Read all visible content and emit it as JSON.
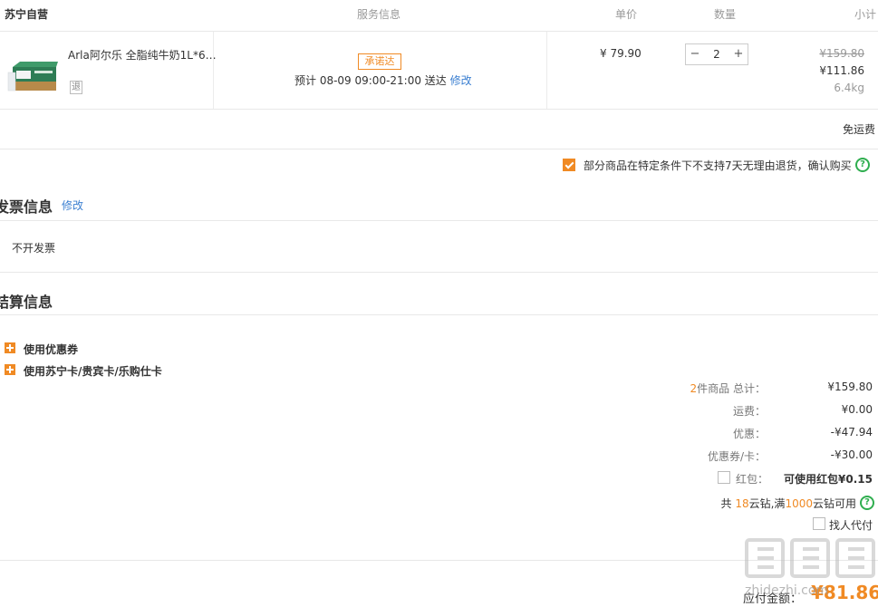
{
  "table_header": {
    "store": "苏宁自营",
    "service": "服务信息",
    "unit_price": "单价",
    "quantity": "数量",
    "subtotal": "小计"
  },
  "item": {
    "name": "Arla阿尔乐 全脂纯牛奶1L*6…",
    "return_badge": "退",
    "promise_badge": "承诺达",
    "delivery": "预计 08-09 09:00-21:00 送达",
    "modify": "修改",
    "price": "¥ 79.90",
    "quantity": "2",
    "original_subtotal": "¥159.80",
    "subtotal": "¥111.86",
    "weight": "6.4kg"
  },
  "shipping": {
    "free": "免运费"
  },
  "confirm_return": {
    "text": "部分商品在特定条件下不支持7天无理由退货，确认购买",
    "checked": true
  },
  "invoice": {
    "title": "发票信息",
    "modify": "修改",
    "value": "不开发票"
  },
  "settlement": {
    "title": "结算信息",
    "coupon": "使用优惠券",
    "cards": "使用苏宁卡/贵宾卡/乐购仕卡"
  },
  "summary": {
    "count_num": "2",
    "count_label": "件商品 总计：",
    "total": "¥159.80",
    "freight_label": "运费：",
    "freight": "¥0.00",
    "discount_label": "优惠：",
    "discount": "-¥47.94",
    "coupon_label": "优惠券/卡：",
    "coupon": "-¥30.00",
    "redpack_label": "红包：",
    "redpack_available": "可使用红包¥0.15",
    "diamond_prefix": "共",
    "diamond_count": "18",
    "diamond_mid": "云钻,满",
    "diamond_threshold": "1000",
    "diamond_suffix": "云钻可用",
    "proxy_pay": "找人代付",
    "payable_label": "应付金额：",
    "payable": "¥81.86"
  },
  "watermark": {
    "logo": "值值值",
    "site": "zhidezhi.com"
  },
  "colors": {
    "accent": "#f08a24",
    "link": "#3b7fd1",
    "help": "#2fae4f"
  }
}
